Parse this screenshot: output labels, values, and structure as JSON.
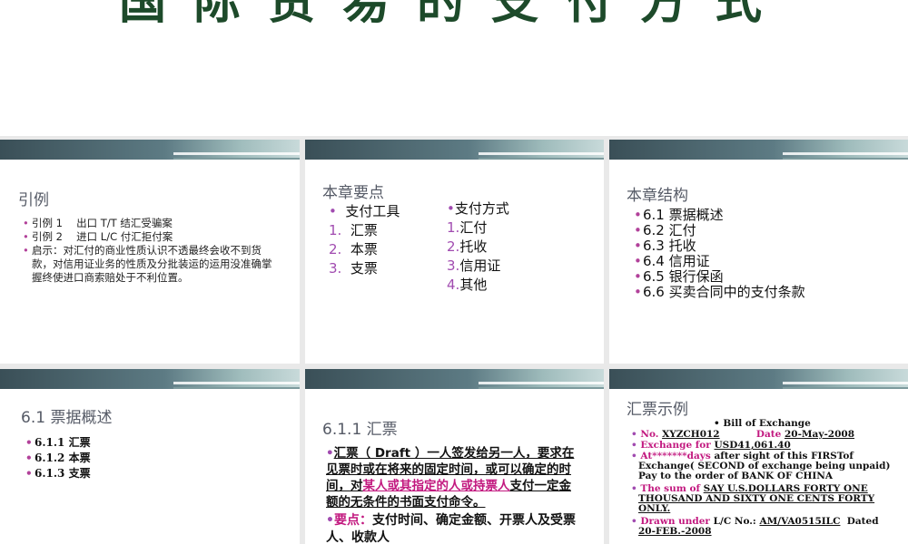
{
  "top_title": "国际贸易的支付方式",
  "s1": {
    "title": "引例",
    "items": [
      "引例 1　  出口 T/T 结汇受骗案",
      "引例 2　  进口 L/C 付汇拒付案",
      "启示：对汇付的商业性质认识不透最终会收不到货款，对信用证业务的性质及分批装运的运用没准确掌握终使进口商索赔处于不利位置。"
    ]
  },
  "s2": {
    "title": "本章要点",
    "tools_head": "支付工具",
    "tools": [
      {
        "n": "1.",
        "t": "汇票"
      },
      {
        "n": "2.",
        "t": "本票"
      },
      {
        "n": "3.",
        "t": "支票"
      }
    ],
    "ways_head": "支付方式",
    "ways": [
      {
        "n": "1.",
        "t": "汇付"
      },
      {
        "n": "2.",
        "t": "托收"
      },
      {
        "n": "3.",
        "t": "信用证"
      },
      {
        "n": "4.",
        "t": "其他"
      }
    ]
  },
  "s3": {
    "title": "本章结构",
    "items": [
      "6.1  票据概述",
      "6.2  汇付",
      "6.3  托收",
      "6.4  信用证",
      "6.5  银行保函",
      "6.6  买卖合同中的支付条款"
    ]
  },
  "s4": {
    "title": "6.1  票据概述",
    "items": [
      "6.1.1 汇票",
      "6.1.2 本票",
      "6.1.3 支票"
    ]
  },
  "s5": {
    "title": "6.1.1 汇票",
    "def_a": "汇票（ Draft ）一人签发给另一人，要求在见票时或在将来的固定时间，或可以确定的时间，对",
    "def_pink": "某人或其指定的人或持票人",
    "def_b": "支付一定金额的无条件的书面支付命令。",
    "key_label": "要点：",
    "key_text": "支付时间、确定金额、开票人及受票人、收款人"
  },
  "s6": {
    "title": "汇票示例",
    "heading": "Bill of Exchange",
    "no_label": "No.",
    "no_value": "XYZCH012",
    "date_label": "Date",
    "date_value": "20-May-2008",
    "exch_label": "Exchange for",
    "exch_value": "USD41,061.40",
    "at_label": "At*******days",
    "at_text": "after sight of this FIRSTof Exchange( SECOND of exchange  being unpaid)    Pay to the order of  BANK OF CHINA",
    "sum_label": "The sum of",
    "sum_value": "SAY U.S.DOLLARS FORTY ONE THOUSAND AND SIXTY ONE CENTS FORTY  ONLY.",
    "drawn_label": "Drawn under",
    "drawn_text": "L/C No.:",
    "drawn_value": "AM/VA0515ILC",
    "dated_label": "Dated",
    "dated_value": "20-FEB.-2008"
  }
}
